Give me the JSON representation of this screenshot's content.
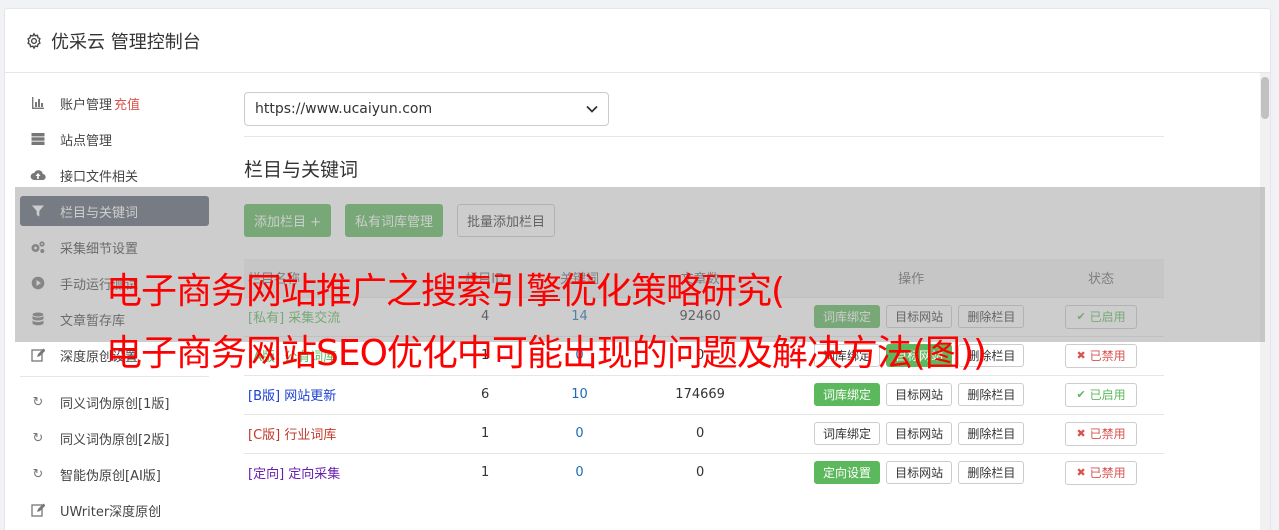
{
  "header": {
    "title": "优采云 管理控制台",
    "icon": "gear-icon"
  },
  "sidebar": {
    "items": [
      {
        "label": "账户管理",
        "extra": "充值",
        "icon": "bar-chart-icon"
      },
      {
        "label": "站点管理",
        "icon": "server-icon"
      },
      {
        "label": "接口文件相关",
        "icon": "cloud-upload-icon"
      },
      {
        "label": "栏目与关键词",
        "icon": "filter-icon",
        "active": true
      },
      {
        "label": "采集细节设置",
        "icon": "cogs-icon"
      },
      {
        "label": "手动运行测试",
        "icon": "play-circle-icon"
      },
      {
        "label": "文章暂存库",
        "icon": "database-icon"
      },
      {
        "label": "深度原创设置",
        "icon": "edit-icon"
      }
    ],
    "items2": [
      {
        "label": "同义词伪原创[1版]",
        "icon": "refresh-icon"
      },
      {
        "label": "同义词伪原创[2版]",
        "icon": "refresh-icon"
      },
      {
        "label": "智能伪原创[AI版]",
        "icon": "refresh-icon"
      },
      {
        "label": "UWriter深度原创",
        "icon": "edit-icon"
      }
    ]
  },
  "main": {
    "site_select": "https://www.ucaiyun.com",
    "section_title": "栏目与关键词",
    "toolbar": {
      "add": "添加栏目 +",
      "private_lib": "私有词库管理",
      "batch_add": "批量添加栏目"
    },
    "table": {
      "columns": [
        "栏目名称",
        "栏目ID",
        "关键词",
        "文章数",
        "操作",
        "状态"
      ],
      "rows": [
        {
          "tag": "[私有]",
          "name": "采集交流",
          "col_id": "4",
          "keywords": "14",
          "articles": "92460",
          "op1": "词库绑定",
          "op1_green": true,
          "op2": "目标网站",
          "op3": "删除栏目",
          "status": "已启用",
          "enabled": true
        },
        {
          "tag": "[A版]",
          "name": "公有词库",
          "col_id": "1",
          "keywords": "0",
          "articles": "0",
          "op1": "词库绑定",
          "op1_green": false,
          "op2": "目标网站",
          "op2_green": true,
          "op3": "删除栏目",
          "status": "已禁用",
          "enabled": false
        },
        {
          "tag": "[B版]",
          "name": "网站更新",
          "col_id": "6",
          "keywords": "10",
          "articles": "174669",
          "op1": "词库绑定",
          "op1_green": true,
          "op2": "目标网站",
          "op3": "删除栏目",
          "status": "已启用",
          "enabled": true
        },
        {
          "tag": "[C版]",
          "name": "行业词库",
          "col_id": "1",
          "keywords": "0",
          "articles": "0",
          "op1": "词库绑定",
          "op1_green": false,
          "op2": "目标网站",
          "op3": "删除栏目",
          "status": "已禁用",
          "enabled": false
        },
        {
          "tag": "[定向]",
          "name": "定向采集",
          "col_id": "1",
          "keywords": "0",
          "articles": "0",
          "op1": "定向设置",
          "op1_green": true,
          "op2": "目标网站",
          "op3": "删除栏目",
          "status": "已禁用",
          "enabled": false
        }
      ]
    }
  },
  "overlay": {
    "line1": "电子商务网站推广之搜索引擎优化策略研究(",
    "line2": "电子商务网站SEO优化中可能出现的问题及解决方法(图))"
  },
  "colors": {
    "green": "#5cb85c",
    "active_nav": "#5a6371",
    "danger": "#d9534f",
    "headline": "#ff0000"
  }
}
